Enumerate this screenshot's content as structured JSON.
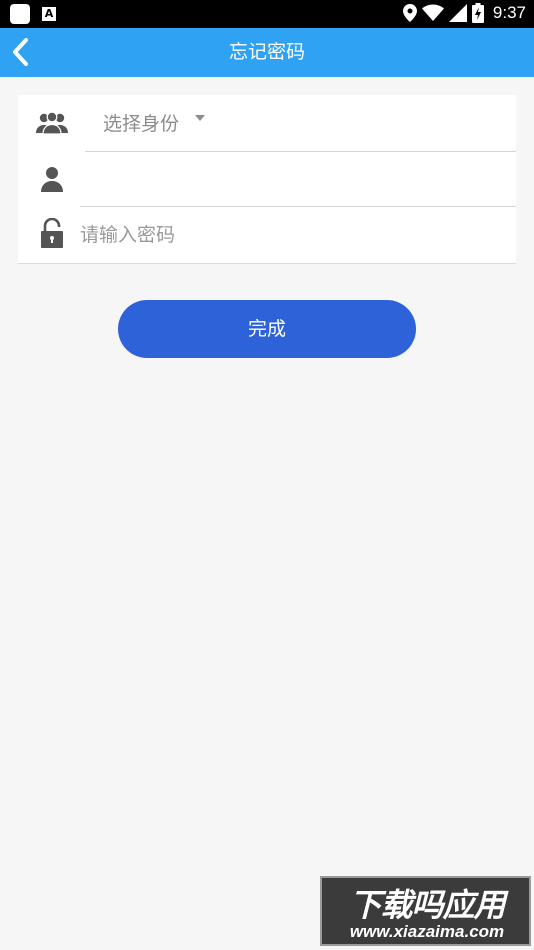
{
  "status_bar": {
    "time": "9:37",
    "icons": [
      "app-square-icon",
      "font-a-icon",
      "location-pin-icon",
      "wifi-icon",
      "signal-icon",
      "battery-charging-icon"
    ],
    "notification_letter": "A"
  },
  "app_bar": {
    "title": "忘记密码",
    "back_icon": "chevron-left-icon",
    "color": "#2fa2f4"
  },
  "form": {
    "identity_select": {
      "label": "选择身份",
      "icon": "users-group-icon"
    },
    "username": {
      "value": "",
      "placeholder": "",
      "icon": "user-icon"
    },
    "password": {
      "value": "",
      "placeholder": "请输入密码",
      "icon": "lock-icon"
    }
  },
  "submit": {
    "label": "完成",
    "color": "#2e62d9"
  },
  "watermark": {
    "title": "下载吗应用",
    "url": "www.xiazaima.com"
  }
}
